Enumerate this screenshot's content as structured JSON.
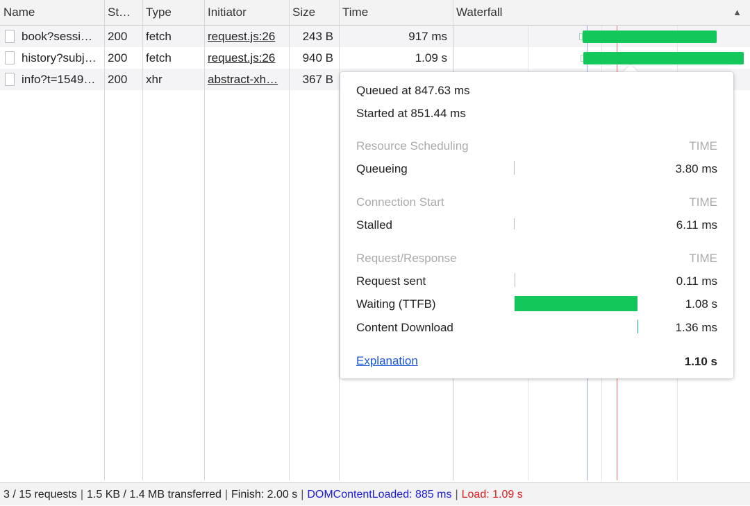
{
  "columns": {
    "name": "Name",
    "status": "St…",
    "type": "Type",
    "initiator": "Initiator",
    "size": "Size",
    "time": "Time",
    "waterfall": "Waterfall",
    "sort_icon": "triangle-up"
  },
  "rows": [
    {
      "name": "book?sessi…",
      "status": "200",
      "type": "fetch",
      "initiator": "request.js:26",
      "size": "243 B",
      "time": "917 ms"
    },
    {
      "name": "history?subj…",
      "status": "200",
      "type": "fetch",
      "initiator": "request.js:26",
      "size": "940 B",
      "time": "1.09 s"
    },
    {
      "name": "info?t=1549…",
      "status": "200",
      "type": "xhr",
      "initiator": "abstract-xh…",
      "size": "367 B",
      "time": ""
    }
  ],
  "tooltip": {
    "queued_at": "Queued at 847.63 ms",
    "started_at": "Started at 851.44 ms",
    "time_header": "TIME",
    "sections": [
      {
        "title": "Resource Scheduling",
        "items": [
          {
            "label": "Queueing",
            "value": "3.80 ms"
          }
        ]
      },
      {
        "title": "Connection Start",
        "items": [
          {
            "label": "Stalled",
            "value": "6.11 ms"
          }
        ]
      },
      {
        "title": "Request/Response",
        "items": [
          {
            "label": "Request sent",
            "value": "0.11 ms"
          },
          {
            "label": "Waiting (TTFB)",
            "value": "1.08 s"
          },
          {
            "label": "Content Download",
            "value": "1.36 ms"
          }
        ]
      }
    ],
    "explanation_link": "Explanation",
    "total": "1.10 s"
  },
  "status_bar": {
    "requests": "3 / 15 requests",
    "transferred": "1.5 KB / 1.4 MB transferred",
    "finish": "Finish: 2.00 s",
    "dom_content_loaded": "DOMContentLoaded: 885 ms",
    "load": "Load: 1.09 s",
    "separator": "|"
  },
  "colors": {
    "bar_green": "#14c75a",
    "dcl_blue": "#1b1bd6",
    "load_red": "#d91c1c",
    "link_blue": "#1a55d6"
  }
}
